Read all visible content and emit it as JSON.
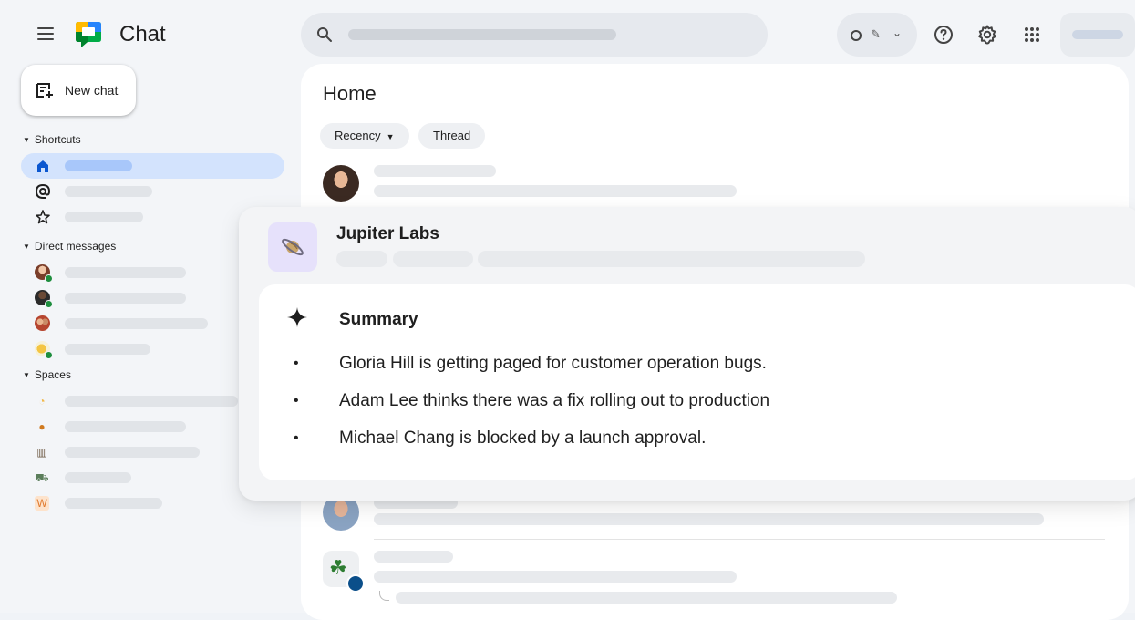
{
  "app": {
    "title": "Chat"
  },
  "sidebar": {
    "new_chat_label": "New chat",
    "shortcuts_label": "Shortcuts",
    "direct_messages_label": "Direct messages",
    "spaces_label": "Spaces",
    "space_w_letter": "W"
  },
  "main": {
    "title": "Home",
    "filters": {
      "recency_label": "Recency",
      "thread_label": "Thread"
    }
  },
  "overlay": {
    "space_name": "Jupiter Labs",
    "summary_title": "Summary",
    "bullets": [
      "Gloria Hill is getting paged for customer operation bugs.",
      "Adam Lee thinks there was a fix rolling out to production",
      "Michael Chang is blocked by a launch approval."
    ]
  },
  "colors": {
    "accent_active": "#d3e3fd",
    "presence_online": "#1e8e3e",
    "space_tile": "#e6e1fb"
  },
  "icons": [
    "menu-icon",
    "chat-logo-icon",
    "search-icon",
    "help-icon",
    "settings-icon",
    "apps-grid-icon",
    "new-chat-icon",
    "home-icon",
    "mentions-icon",
    "star-icon",
    "saturn-icon",
    "sparkle-icon",
    "clover-icon"
  ]
}
